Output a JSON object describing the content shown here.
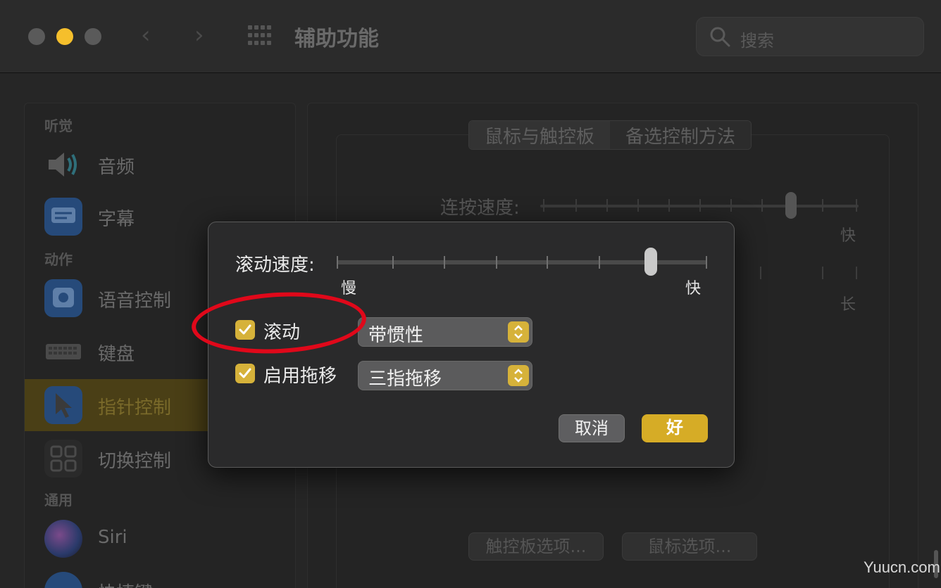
{
  "window": {
    "title": "辅助功能",
    "search_placeholder": "搜索",
    "icons": [
      "close-button",
      "minimize-button",
      "zoom-button",
      "chevron-left-icon",
      "chevron-right-icon",
      "grid-icon",
      "search-icon"
    ]
  },
  "sidebar": {
    "sections": [
      "听觉",
      "动作",
      "通用"
    ],
    "items": [
      {
        "label": "音频",
        "icon": "speaker-icon"
      },
      {
        "label": "字幕",
        "icon": "captions-icon"
      },
      {
        "label": "语音控制",
        "icon": "voice-control-icon"
      },
      {
        "label": "键盘",
        "icon": "keyboard-icon"
      },
      {
        "label": "指针控制",
        "icon": "pointer-icon",
        "selected": true
      },
      {
        "label": "切换控制",
        "icon": "switch-control-icon"
      },
      {
        "label": "Siri",
        "icon": "siri-icon"
      },
      {
        "label": "快捷键",
        "icon": "shortcut-icon"
      }
    ]
  },
  "main": {
    "tabs": [
      "鼠标与触控板",
      "备选控制方法"
    ],
    "double_click_label": "连按速度:",
    "right_label_fast": "快",
    "right_label_long": "长",
    "trackpad_options": "触控板选项...",
    "mouse_options": "鼠标选项..."
  },
  "sheet": {
    "scroll_speed_label": "滚动速度:",
    "slow": "慢",
    "fast": "快",
    "scroll_speed_level": 0.85,
    "scroll_checkbox": {
      "label": "滚动",
      "checked": true,
      "value": "带惯性"
    },
    "drag_checkbox": {
      "label": "启用拖移",
      "checked": true,
      "value": "三指拖移"
    },
    "cancel": "取消",
    "ok": "好"
  },
  "colors": {
    "accent": "#d6ac26",
    "annotation": "#e0081a"
  },
  "watermark": "Yuucn.com"
}
